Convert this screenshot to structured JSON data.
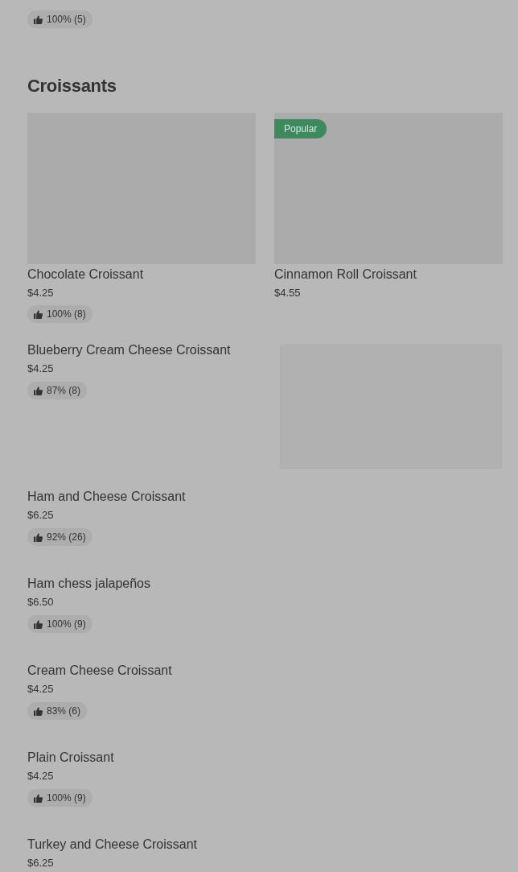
{
  "previous_item": {
    "rating": "100% (5)"
  },
  "section": {
    "title": "Croissants",
    "featured": [
      {
        "name": "Chocolate Croissant",
        "price": "$4.25",
        "rating": "100% (8)"
      },
      {
        "name": "Cinnamon Roll Croissant",
        "price": "$4.55",
        "badge": "Popular"
      }
    ],
    "items": [
      {
        "kind": "image",
        "name": "Blueberry Cream Cheese Croissant",
        "price": "$4.25",
        "rating": "87% (8)"
      },
      {
        "kind": "plain",
        "name": "Ham and Cheese Croissant",
        "price": "$6.25",
        "rating": "92% (26)"
      },
      {
        "kind": "plain",
        "name": "Ham chess jalapeños",
        "price": "$6.50",
        "rating": "100% (9)"
      },
      {
        "kind": "plain",
        "name": "Cream Cheese Croissant",
        "price": "$4.25",
        "rating": "83% (6)"
      },
      {
        "kind": "plain",
        "name": "Plain Croissant",
        "price": "$4.25",
        "rating": "100% (9)"
      },
      {
        "kind": "plain",
        "name": "Turkey and Cheese Croissant",
        "price": "$6.25"
      }
    ]
  }
}
